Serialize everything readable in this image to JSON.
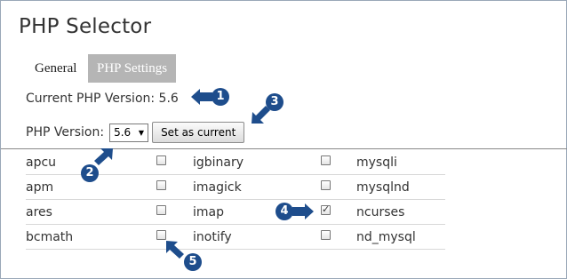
{
  "title": "PHP Selector",
  "tabs": [
    {
      "label": "General",
      "active": false
    },
    {
      "label": "PHP Settings",
      "active": true
    }
  ],
  "current_version": {
    "label": "Current PHP Version:",
    "value": "5.6"
  },
  "version_select": {
    "label": "PHP Version:",
    "value": "5.6"
  },
  "set_current_label": "Set as current",
  "extensions": [
    [
      {
        "name": "apcu",
        "checked": false
      },
      {
        "name": "igbinary",
        "checked": false
      },
      {
        "name": "mysqli",
        "checked": false
      }
    ],
    [
      {
        "name": "apm",
        "checked": false
      },
      {
        "name": "imagick",
        "checked": false
      },
      {
        "name": "mysqlnd",
        "checked": false
      }
    ],
    [
      {
        "name": "ares",
        "checked": false
      },
      {
        "name": "imap",
        "checked": false
      },
      {
        "name": "ncurses",
        "checked": true
      }
    ],
    [
      {
        "name": "bcmath",
        "checked": false
      },
      {
        "name": "inotify",
        "checked": false
      },
      {
        "name": "nd_mysql",
        "checked": false
      }
    ]
  ],
  "callouts": [
    "1",
    "2",
    "3",
    "4",
    "5"
  ],
  "colors": {
    "callout": "#1e4d8c",
    "tab_active_bg": "#b5b5b5"
  }
}
